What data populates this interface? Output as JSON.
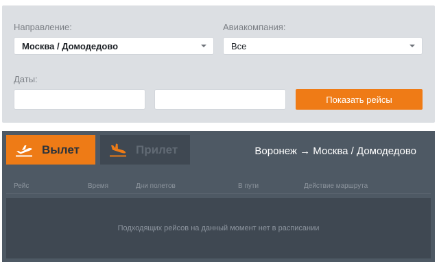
{
  "filters": {
    "direction_label": "Направление:",
    "direction_value": "Москва / Домодедово",
    "airline_label": "Авиакомпания:",
    "airline_value": "Все",
    "dates_label": "Даты:",
    "date_from_value": "",
    "date_to_value": "",
    "show_button": "Показать рейсы"
  },
  "board": {
    "tabs": [
      {
        "label": "Вылет",
        "icon": "plane-takeoff-icon",
        "active": true
      },
      {
        "label": "Прилет",
        "icon": "plane-landing-icon",
        "active": false
      }
    ],
    "route": "Воронеж → Москва / Домодедово",
    "columns": [
      "Рейс",
      "Время",
      "Дни полетов",
      "В пути",
      "Действие маршрута"
    ],
    "empty_message": "Подходящих рейсов на данный момент нет в расписании"
  },
  "colors": {
    "accent": "#ef7b16",
    "board_bg": "#4e5964",
    "panel_bg": "#3f4852",
    "filters_bg": "#dcdfe3"
  }
}
